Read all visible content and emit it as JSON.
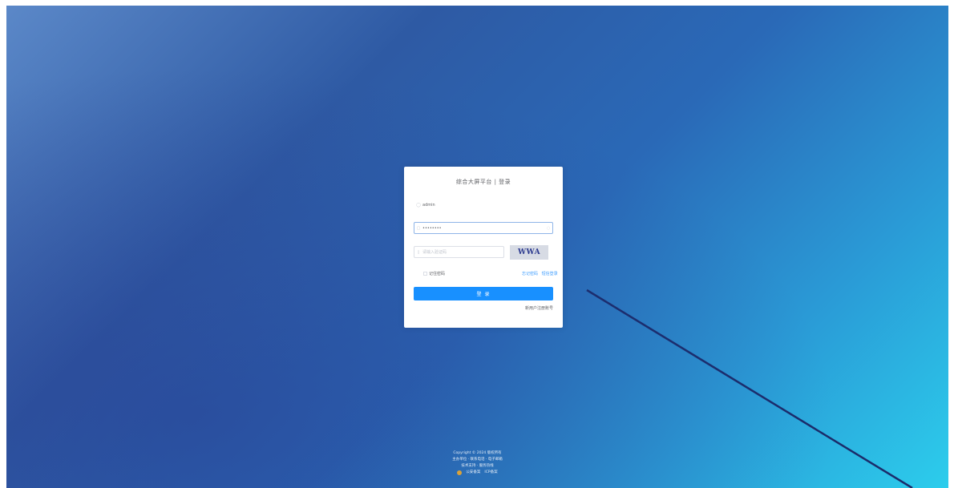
{
  "colors": {
    "bg_start": "#5b88c8",
    "bg_mid": "#2a69b7",
    "bg_end": "#2ccdec",
    "primary": "#1890ff",
    "link": "#409eff"
  },
  "login": {
    "title": "综合大屏平台 | 登录",
    "username": {
      "icon": "user-icon",
      "value": "admin"
    },
    "password": {
      "icon": "lock-icon",
      "value": "••••••••"
    },
    "captcha": {
      "icon": "shield-icon",
      "placeholder": "请输入验证码",
      "image_text": "WWA"
    },
    "remember_label": "记住密码",
    "links": [
      "忘记密码",
      "短信登录"
    ],
    "login_button": "登 录",
    "register_link": "新用户注册账号"
  },
  "footer": {
    "line1": "Copyright © 2024 版权所有",
    "line2": "主办单位 · 联系电话 · 电子邮箱",
    "line3": "技术支持 · 服务热线",
    "line4": [
      "公安备案",
      "ICP备案"
    ]
  }
}
